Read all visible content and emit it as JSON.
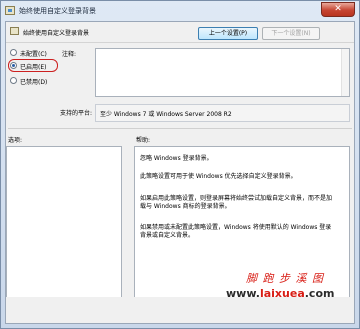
{
  "window": {
    "title": "始终使用自定义登录背景",
    "close_glyph": "✕"
  },
  "header": {
    "title": "始终使用自定义登录背景"
  },
  "nav": {
    "prev_label": "上一个设置(P)",
    "next_label": "下一个设置(N)"
  },
  "state": {
    "options": [
      {
        "label": "未配置(C)",
        "selected": false
      },
      {
        "label": "已启用(E)",
        "selected": true
      },
      {
        "label": "已禁用(D)",
        "selected": false
      }
    ]
  },
  "comment": {
    "label": "注释:",
    "value": ""
  },
  "platform": {
    "label": "支持的平台:",
    "value": "至少 Windows 7 或 Windows Server 2008 R2"
  },
  "options_panel": {
    "label": "选项:"
  },
  "help_panel": {
    "label": "帮助:",
    "paragraphs": [
      "忽略 Windows 登录背景。",
      "此策略设置可用于使 Windows 优先选择自定义登录背景。",
      "如果启用此策略设置，则登录屏幕将始终尝试加载自定义背景，而不是加载与 Windows 商标的登录背景。",
      "如果禁用或未配置此策略设置，Windows 将使用默认的 Windows 登录背景或自定义背景。"
    ]
  },
  "watermark": {
    "site_name": "脚 跑 步 溪 图",
    "url_prefix": "www.",
    "url_main": "laixuea",
    "url_suffix": ".com"
  },
  "colors": {
    "accent": "#3c7fb1",
    "highlight": "#cc2020",
    "watermark_red": "#d81c14"
  }
}
